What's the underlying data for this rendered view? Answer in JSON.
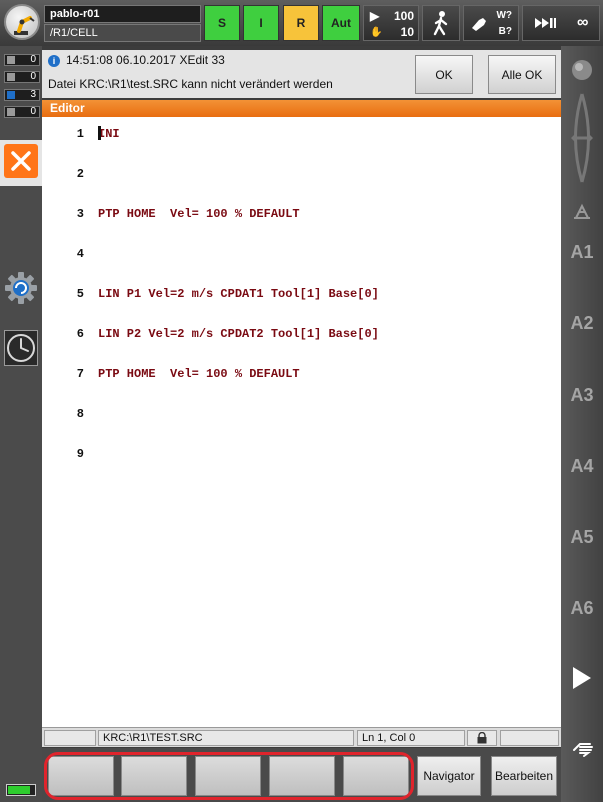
{
  "header": {
    "robot_name": "pablo-r01",
    "robot_path": "/R1/CELL",
    "status_s": "S",
    "status_i": "I",
    "status_r": "R",
    "mode": "Aut",
    "program_override": "100",
    "jog_override": "10",
    "tool_label": "W?",
    "base_label": "B?",
    "increment": "∞",
    "colors": {
      "green": "#3fcf3f",
      "yellow": "#f7c33a"
    }
  },
  "messages": {
    "counts": [
      "0",
      "0",
      "3",
      "0"
    ],
    "current": {
      "time": "14:51:08 06.10.2017 XEdit 33",
      "text": "Datei KRC:\\R1\\test.SRC kann nicht verändert werden",
      "ok_label": "OK",
      "all_ok_label": "Alle OK"
    }
  },
  "editor": {
    "title": "Editor",
    "lines": [
      {
        "num": "1",
        "code": "INI"
      },
      {
        "num": "2",
        "code": ""
      },
      {
        "num": "3",
        "code": "PTP HOME  Vel= 100 % DEFAULT"
      },
      {
        "num": "4",
        "code": ""
      },
      {
        "num": "5",
        "code": "LIN P1 Vel=2 m/s CPDAT1 Tool[1] Base[0]"
      },
      {
        "num": "6",
        "code": "LIN P2 Vel=2 m/s CPDAT2 Tool[1] Base[0]"
      },
      {
        "num": "7",
        "code": "PTP HOME  Vel= 100 % DEFAULT"
      },
      {
        "num": "8",
        "code": ""
      },
      {
        "num": "9",
        "code": ""
      }
    ],
    "code_color": "#7a0a12"
  },
  "statusbar": {
    "file": "KRC:\\R1\\TEST.SRC",
    "position": "Ln 1, Col 0"
  },
  "softkeys": {
    "navigator": "Navigator",
    "edit": "Bearbeiten",
    "highlight_color": "#e0242c"
  },
  "axes": [
    "A1",
    "A2",
    "A3",
    "A4",
    "A5",
    "A6"
  ]
}
